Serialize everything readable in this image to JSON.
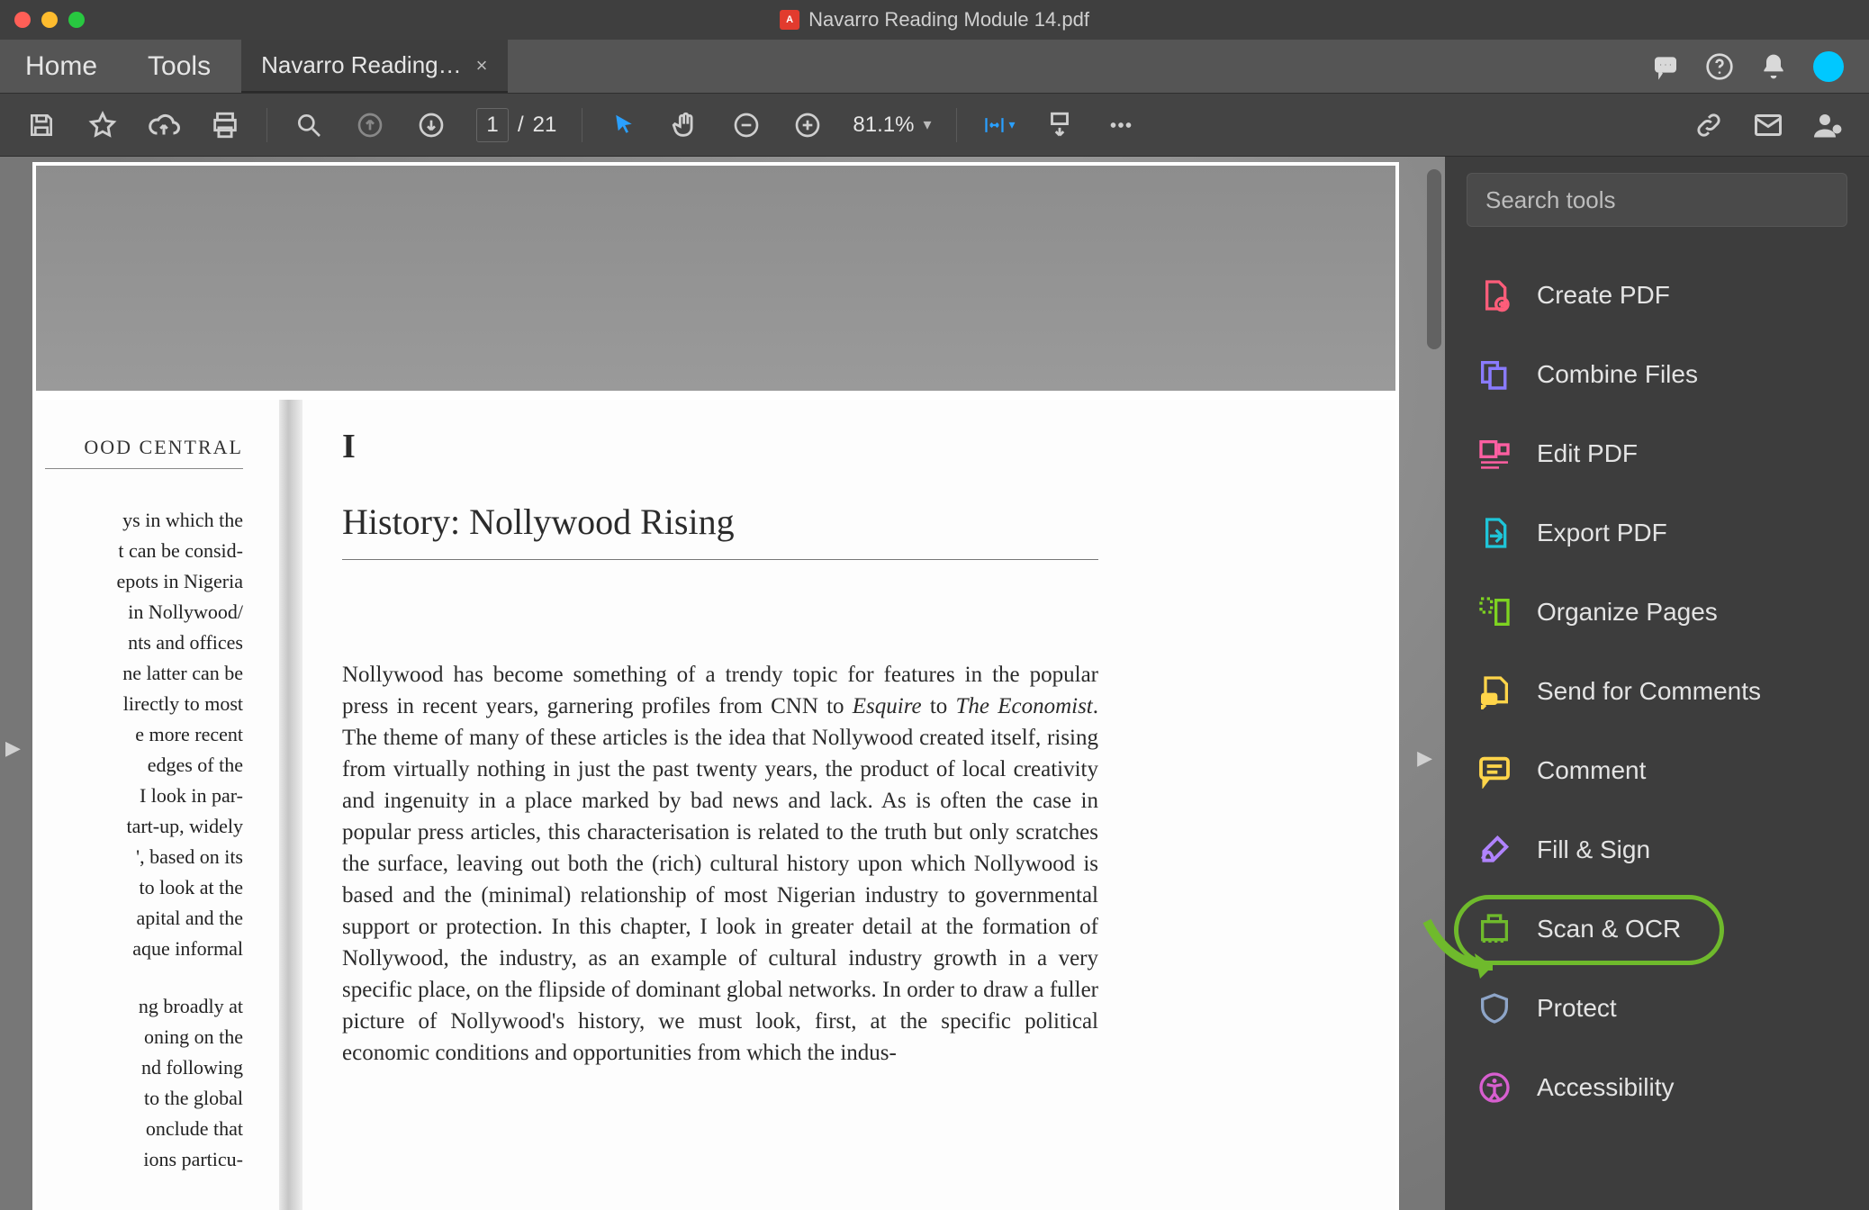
{
  "window": {
    "title": "Navarro Reading Module 14.pdf"
  },
  "tabs": {
    "home": "Home",
    "tools": "Tools",
    "file_tab": "Navarro Reading…",
    "close_glyph": "×"
  },
  "toolbar": {
    "page_current": "1",
    "page_sep": "/",
    "page_total": "21",
    "zoom_value": "81.1%"
  },
  "right_panel": {
    "search_placeholder": "Search tools",
    "items": [
      {
        "label": "Create PDF",
        "color": "#ff5d7a"
      },
      {
        "label": "Combine Files",
        "color": "#8a7bff"
      },
      {
        "label": "Edit PDF",
        "color": "#ff5fa2"
      },
      {
        "label": "Export PDF",
        "color": "#1fc5d8"
      },
      {
        "label": "Organize Pages",
        "color": "#7ed321"
      },
      {
        "label": "Send for Comments",
        "color": "#ffd54a"
      },
      {
        "label": "Comment",
        "color": "#ffd54a"
      },
      {
        "label": "Fill & Sign",
        "color": "#b083ff"
      },
      {
        "label": "Scan & OCR",
        "color": "#6fba2c",
        "highlight": true
      },
      {
        "label": "Protect",
        "color": "#8ea5c8"
      },
      {
        "label": "Accessibility",
        "color": "#d85fd0"
      }
    ]
  },
  "page_content": {
    "left_header": "OOD CENTRAL",
    "left_para1": "ys in which the\nt can be consid-\nepots in Nigeria\n in Nollywood/\nnts and offices\nne latter can be\nlirectly to most\ne more recent\n edges of the\n I look in par-\ntart-up, widely\n', based on its\nto look at the\napital and the\naque informal",
    "left_para2": "ng broadly at\noning on the\nnd following\nto the global\nonclude that\nions particu-",
    "chapter_number": "I",
    "chapter_title": "History: Nollywood Rising",
    "body_html": "Nollywood has become something of a trendy topic for features in the popular press in recent years, garnering profiles from CNN to <em>Esquire</em> to <em>The Economist</em>. The theme of many of these articles is the idea that Nollywood created itself, rising from virtually nothing in just the past twenty years, the product of local creativity and ingenuity in a place marked by bad news and lack. As is often the case in popular press articles, this characterisation is related to the truth but only scratches the surface, leaving out both the (rich) cultural history upon which Nollywood is based and the (minimal) relationship of most Nigerian industry to governmental support or protection. In this chapter, I look in greater detail at the formation of Nollywood, the industry, as an example of cultural industry growth in a very specific place, on the flipside of dominant global networks. In order to draw a fuller picture of Nollywood's history, we must look, first, at the specific political economic conditions and opportunities from which the indus-"
  }
}
